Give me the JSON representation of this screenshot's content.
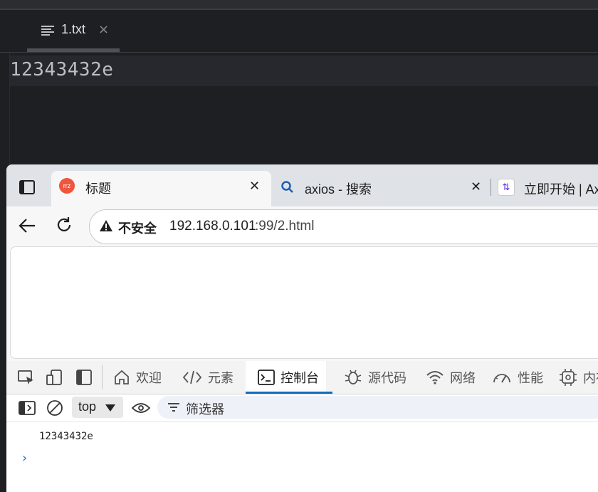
{
  "editor": {
    "tab": {
      "label": "1.txt",
      "close": "×",
      "icon": "text-file-icon"
    },
    "lines": [
      "12343432e"
    ]
  },
  "browser": {
    "tabs": [
      {
        "title": "标题",
        "icon": "rrz-favicon-icon",
        "favicon_text": "rrz",
        "close": "✕",
        "active": true
      },
      {
        "title": "axios - 搜索",
        "icon": "search-icon",
        "close": "✕",
        "active": false
      },
      {
        "title": "立即开始 | Ax",
        "icon": "axios-favicon-icon",
        "favicon_text": "⇅",
        "active": false
      }
    ],
    "address": {
      "security_label": "不安全",
      "host": "192.168.0.101",
      "port_path": ":99/2.html"
    }
  },
  "devtools": {
    "tabs": [
      {
        "label": "欢迎",
        "icon": "home-icon"
      },
      {
        "label": "元素",
        "icon": "code-icon"
      },
      {
        "label": "控制台",
        "icon": "console-icon",
        "active": true
      },
      {
        "label": "源代码",
        "icon": "bug-icon"
      },
      {
        "label": "网络",
        "icon": "wifi-icon"
      },
      {
        "label": "性能",
        "icon": "gauge-icon"
      },
      {
        "label": "内存",
        "icon": "chip-icon"
      }
    ],
    "console": {
      "context": "top",
      "filter_placeholder": "筛选器",
      "messages": [
        "12343432e"
      ],
      "prompt": "›"
    }
  },
  "colors": {
    "editor_bg": "#1e1f22",
    "editor_text": "#bcbec4",
    "active_underline": "#0f6cbd",
    "favicon_bg": "#f0553d"
  }
}
